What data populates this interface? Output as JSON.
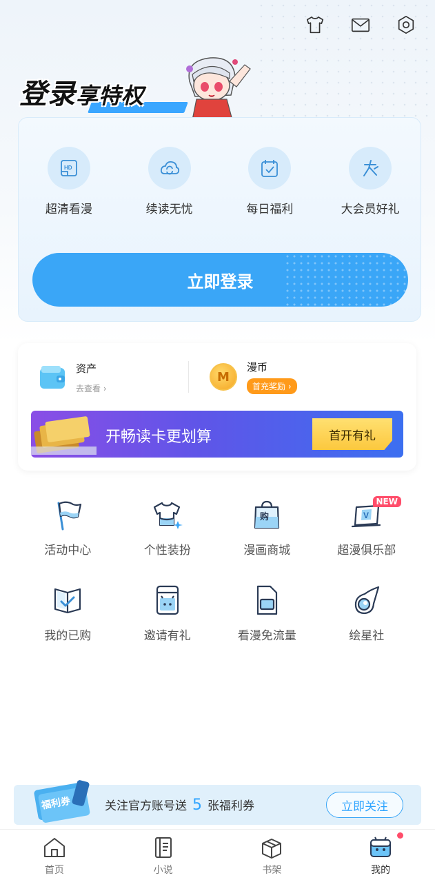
{
  "topbar": {
    "icons": [
      "tshirt-icon",
      "mail-icon",
      "settings-icon"
    ]
  },
  "login_promo": {
    "title_big": "登录",
    "title_small": "享特权",
    "perks": [
      {
        "label": "超清看漫",
        "icon": "hd-icon"
      },
      {
        "label": "续读无忧",
        "icon": "cloud-sync-icon"
      },
      {
        "label": "每日福利",
        "icon": "calendar-check-icon"
      },
      {
        "label": "大会员好礼",
        "icon": "vip-icon"
      }
    ],
    "login_button": "立即登录"
  },
  "wallet": {
    "assets_title": "资产",
    "assets_link": "去查看",
    "coins_title": "漫币",
    "coins_badge": "首充奖励",
    "vip_banner_text": "开畅读卡更划算",
    "vip_banner_button": "首开有礼"
  },
  "features": [
    {
      "label": "活动中心",
      "icon": "flag-icon"
    },
    {
      "label": "个性装扮",
      "icon": "outfit-icon"
    },
    {
      "label": "漫画商城",
      "icon": "shopping-bag-icon"
    },
    {
      "label": "超漫俱乐部",
      "icon": "club-icon",
      "badge": "NEW"
    },
    {
      "label": "我的已购",
      "icon": "purchased-icon"
    },
    {
      "label": "邀请有礼",
      "icon": "invite-icon"
    },
    {
      "label": "看漫免流量",
      "icon": "sim-card-icon"
    },
    {
      "label": "绘星社",
      "icon": "comet-icon"
    }
  ],
  "follow_banner": {
    "coupon_text": "福利券",
    "text_before": "关注官方账号送",
    "count": "5",
    "text_after": "张福利券",
    "button": "立即关注"
  },
  "bottom_nav": [
    {
      "label": "首页",
      "icon": "home-icon",
      "active": false
    },
    {
      "label": "小说",
      "icon": "novel-icon",
      "active": false
    },
    {
      "label": "书架",
      "icon": "bookshelf-icon",
      "active": false
    },
    {
      "label": "我的",
      "icon": "profile-icon",
      "active": true
    }
  ],
  "colors": {
    "accent": "#3aa6f7",
    "badge": "#ff4d6a",
    "coin": "#ff9a1a"
  }
}
